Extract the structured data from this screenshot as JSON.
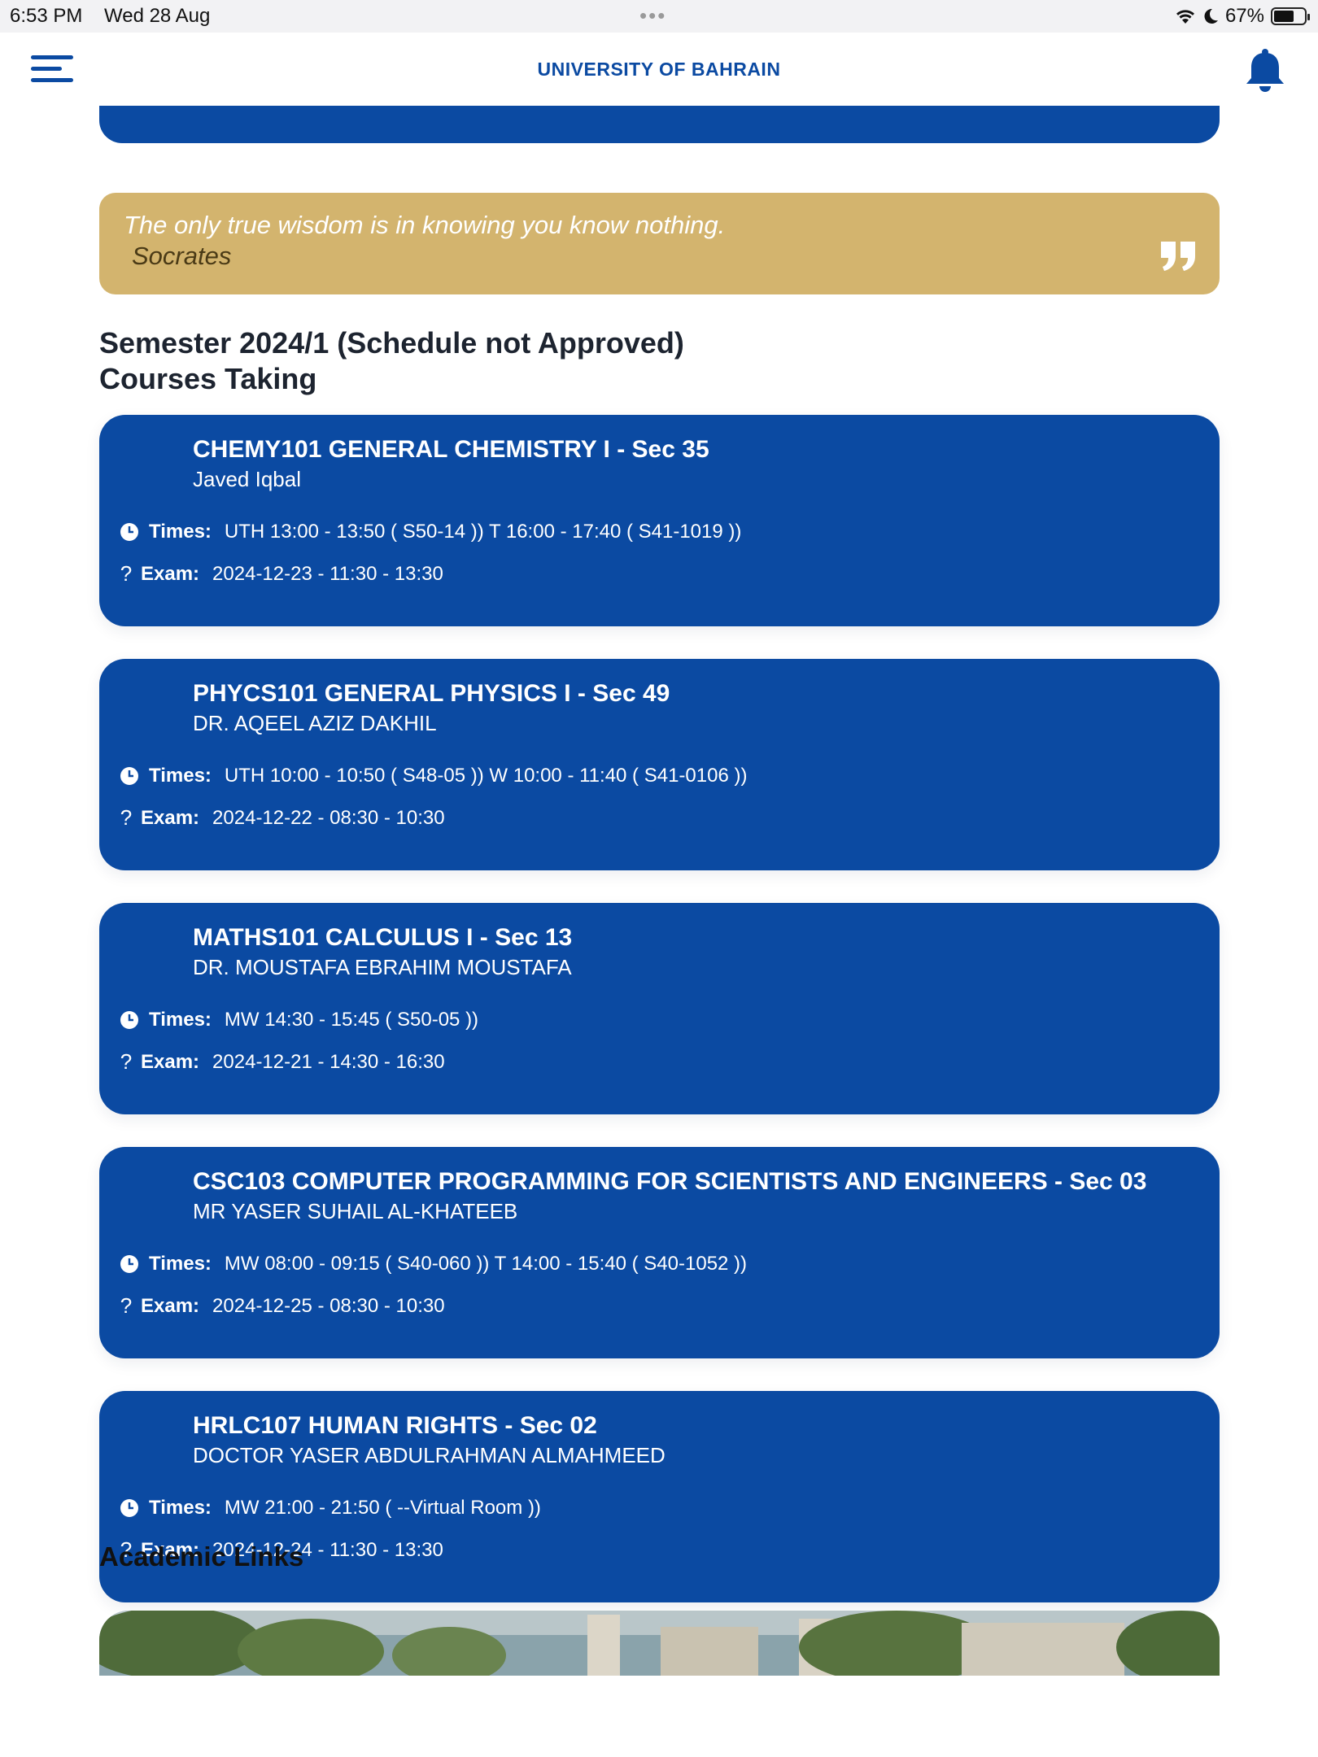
{
  "status_bar": {
    "time": "6:53 PM",
    "date": "Wed 28 Aug",
    "battery": "67%",
    "battery_level": 0.67
  },
  "header": {
    "title": "UNIVERSITY OF BAHRAIN",
    "menu_icon": "menu-icon",
    "notification_icon": "bell-icon"
  },
  "quote": {
    "text": "The only true wisdom is in knowing you know nothing.",
    "author": "Socrates",
    "icon": "quote-icon"
  },
  "semester": {
    "title": "Semester 2024/1 (Schedule not Approved)",
    "subtitle": "Courses Taking"
  },
  "labels": {
    "times": "Times:",
    "exam": "Exam:",
    "exam_icon": "?"
  },
  "courses": [
    {
      "title": "CHEMY101 GENERAL CHEMISTRY I - Sec 35",
      "instructor": "Javed Iqbal",
      "times": "UTH  13:00 - 13:50  ( S50-14 )) T  16:00 - 17:40  ( S41-1019 ))",
      "exam": "2024-12-23 - 11:30 - 13:30"
    },
    {
      "title": "PHYCS101 GENERAL PHYSICS I - Sec 49",
      "instructor": "DR. AQEEL AZIZ DAKHIL",
      "times": "UTH  10:00 - 10:50  ( S48-05 )) W  10:00 - 11:40  ( S41-0106 ))",
      "exam": "2024-12-22 - 08:30 - 10:30"
    },
    {
      "title": "MATHS101 CALCULUS I - Sec 13",
      "instructor": "DR. MOUSTAFA EBRAHIM MOUSTAFA",
      "times": "MW  14:30 - 15:45  ( S50-05 ))",
      "exam": "2024-12-21 - 14:30 - 16:30"
    },
    {
      "title": "CSC103 COMPUTER PROGRAMMING FOR SCIENTISTS AND ENGINEERS - Sec 03",
      "instructor": "MR YASER SUHAIL AL-KHATEEB",
      "times": "MW  08:00 - 09:15  ( S40-060 )) T  14:00 - 15:40  ( S40-1052 ))",
      "exam": "2024-12-25 - 08:30 - 10:30"
    },
    {
      "title": "HRLC107 HUMAN RIGHTS - Sec 02",
      "instructor": "DOCTOR YASER ABDULRAHMAN ALMAHMEED",
      "times": "MW  21:00 - 21:50  ( --Virtual Room ))",
      "exam": "2024-12-24 - 11:30 - 13:30"
    }
  ],
  "academic_links": {
    "title": "Academic Links"
  },
  "colors": {
    "primary": "#0b4aa2",
    "quote_bg": "#d3b46e",
    "quote_author": "#4a3a16"
  }
}
